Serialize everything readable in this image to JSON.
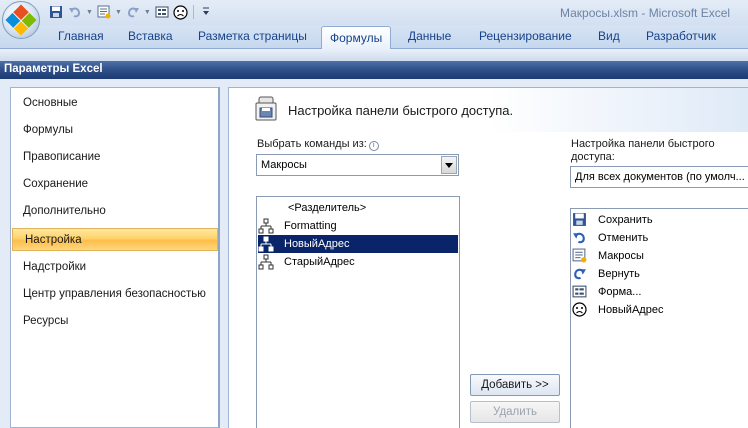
{
  "window": {
    "title": "Макросы.xlsm - Microsoft Excel"
  },
  "icons": {
    "office": "office-button-icon",
    "save": "save-icon",
    "undo": "undo-icon",
    "redo": "redo-icon",
    "macros": "macros-icon",
    "form": "form-icon",
    "frown": "frown-face-icon",
    "macro": "macro-tree-icon",
    "customize": "quick-access-customize-icon",
    "info": "info-icon"
  },
  "colors": {
    "selected_nav": "#ffc75a",
    "selected_list": "#0a246a",
    "dialog_title": "#2f4f89",
    "ribbon_text": "#15428b"
  },
  "ribbon": {
    "tabs": [
      "Главная",
      "Вставка",
      "Разметка страницы",
      "Формулы",
      "Данные",
      "Рецензирование",
      "Вид",
      "Разработчик"
    ],
    "active_tab": "Формулы"
  },
  "dialog": {
    "title": "Параметры Excel",
    "nav": [
      "Основные",
      "Формулы",
      "Правописание",
      "Сохранение",
      "Дополнительно",
      "Настройка",
      "Надстройки",
      "Центр управления безопасностью",
      "Ресурсы"
    ],
    "selected_nav": "Настройка",
    "header": "Настройка панели быстрого доступа.",
    "choose_label": "Выбрать команды из:",
    "choose_value": "Макросы",
    "commands": [
      "<Разделитель>",
      "Formatting",
      "НовыйАдрес",
      "СтарыйАдрес"
    ],
    "selected_command": "НовыйАдрес",
    "qat_label_line1": "Настройка панели быстрого",
    "qat_label_line2": "доступа:",
    "qat_value": "Для всех документов (по умолч...",
    "qat_items": [
      "Сохранить",
      "Отменить",
      "Макросы",
      "Вернуть",
      "Форма...",
      "НовыйАдрес"
    ],
    "add_button": "Добавить >>",
    "remove_button": "Удалить"
  }
}
